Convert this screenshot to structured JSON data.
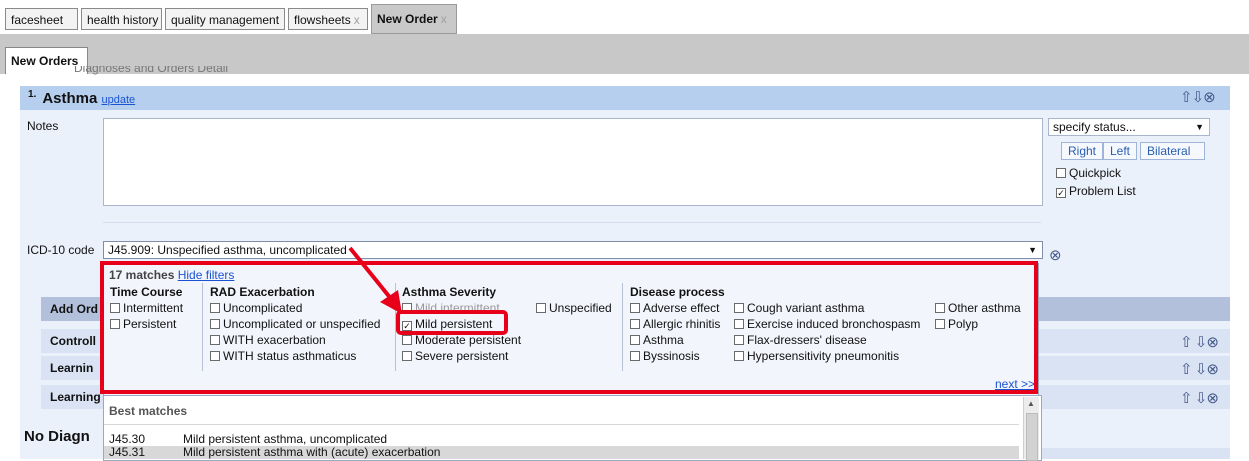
{
  "tabs": [
    {
      "label": "facesheet",
      "closable": false
    },
    {
      "label": "health history",
      "closable": false
    },
    {
      "label": "quality management",
      "closable": false
    },
    {
      "label": "flowsheets",
      "closable": true
    },
    {
      "label": "New Order",
      "closable": true,
      "active": true
    }
  ],
  "close_glyph": "x",
  "subtab": {
    "label": "New Orders"
  },
  "section_title_cut": "Diagnoses and Orders Detail",
  "diagnosis": {
    "number": "1.",
    "name": "Asthma",
    "update_link": "update"
  },
  "notes": {
    "label": "Notes",
    "value": ""
  },
  "status": {
    "select_value": "specify status...",
    "buttons": [
      "Right",
      "Left",
      "Bilateral"
    ],
    "quickpick": {
      "label": "Quickpick",
      "checked": false
    },
    "problem_list": {
      "label": "Problem List",
      "checked": true
    }
  },
  "icd": {
    "label": "ICD-10 code",
    "value": "J45.909: Unspecified asthma, uncomplicated"
  },
  "rows": [
    "Add Ord",
    "Controll",
    "Learnin",
    "Learning"
  ],
  "no_diagnosis": "No Diagn",
  "filters": {
    "match_count": "17 matches",
    "hide_link": "Hide filters",
    "groups": [
      {
        "title": "Time Course",
        "options": [
          {
            "label": "Intermittent",
            "checked": false
          },
          {
            "label": "Persistent",
            "checked": false
          }
        ]
      },
      {
        "title": "RAD Exacerbation",
        "options": [
          {
            "label": "Uncomplicated",
            "checked": false
          },
          {
            "label": "Uncomplicated or unspecified",
            "checked": false
          },
          {
            "label": "WITH exacerbation",
            "checked": false
          },
          {
            "label": "WITH status asthmaticus",
            "checked": false
          }
        ]
      },
      {
        "title": "Asthma Severity",
        "options": [
          {
            "label": "Mild intermittent",
            "checked": false
          },
          {
            "label": "Mild persistent",
            "checked": true
          },
          {
            "label": "Moderate persistent",
            "checked": false
          },
          {
            "label": "Severe persistent",
            "checked": false
          },
          {
            "label": "Unspecified",
            "checked": false
          }
        ]
      },
      {
        "title": "Disease process",
        "options": [
          {
            "label": "Adverse effect",
            "checked": false
          },
          {
            "label": "Allergic rhinitis",
            "checked": false
          },
          {
            "label": "Asthma",
            "checked": false
          },
          {
            "label": "Byssinosis",
            "checked": false
          },
          {
            "label": "Cough variant asthma",
            "checked": false
          },
          {
            "label": "Exercise induced bronchospasm",
            "checked": false
          },
          {
            "label": "Flax-dressers' disease",
            "checked": false
          },
          {
            "label": "Hypersensitivity pneumonitis",
            "checked": false
          },
          {
            "label": "Other asthma",
            "checked": false
          },
          {
            "label": "Polyp",
            "checked": false
          }
        ]
      }
    ],
    "next_link": "next >>"
  },
  "best_matches": {
    "header": "Best matches",
    "items": [
      {
        "code": "J45.30",
        "description": "Mild persistent asthma, uncomplicated",
        "selected": false
      },
      {
        "code": "J45.31",
        "description": "Mild persistent asthma with (acute) exacerbation",
        "selected": true
      }
    ]
  },
  "icons": {
    "move_up": "arrow-up-icon",
    "move_down": "arrow-down-icon",
    "remove": "circle-x-icon",
    "annotation_arrow": "red-arrow-annotation",
    "annotation_box": "red-highlight-box"
  },
  "colors": {
    "annotation": "#e8001b",
    "header_bar": "#b7cfef",
    "panel": "#ebf1fb",
    "link": "#1a53d1"
  }
}
